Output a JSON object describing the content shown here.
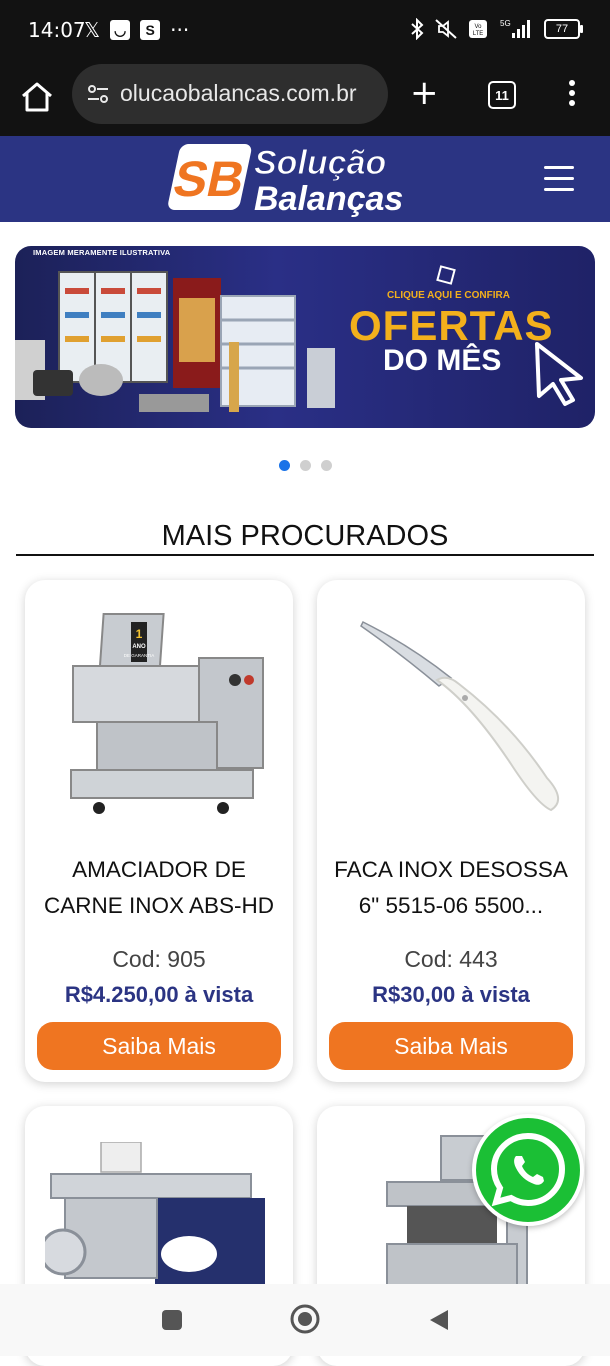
{
  "statusbar": {
    "time": "14:07",
    "battery": "77",
    "left_icons": [
      "x-icon",
      "smiley-icon",
      "s-icon",
      "more-icon"
    ],
    "right_icons": [
      "bluetooth-icon",
      "mute-icon",
      "volte-icon",
      "signal-5g-icon"
    ],
    "net_label": "5G"
  },
  "browser": {
    "url": "olucaobalancas.com.br",
    "tab_count": "11"
  },
  "header": {
    "logo_line1": "Solução",
    "logo_line2": "Balanças",
    "logo_mark": "SB"
  },
  "banner": {
    "note": "IMAGEM MERAMENTE ILUSTRATIVA",
    "cta": "CLIQUE AQUI E CONFIRA",
    "headline1": "OFERTAS",
    "headline2": "DO MÊS",
    "slides": 3,
    "active_slide": 1
  },
  "section": {
    "title": "MAIS PROCURADOS"
  },
  "products": [
    {
      "name": "AMACIADOR DE CARNE INOX ABS-HD",
      "code": "Cod: 905",
      "price": "R$4.250,00 à vista",
      "button": "Saiba Mais",
      "badge_1": "1",
      "badge_2": "ANO",
      "badge_3": "DE GARANTIA"
    },
    {
      "name": "FACA INOX DESOSSA 6\" 5515-06 5500...",
      "code": "Cod: 443",
      "price": "R$30,00 à vista",
      "button": "Saiba Mais"
    },
    {
      "name": "",
      "code": "",
      "price": "",
      "button": ""
    },
    {
      "name": "",
      "code": "",
      "price": "",
      "button": ""
    }
  ],
  "colors": {
    "header_bg": "#2b3483",
    "accent_orange": "#ef7521",
    "price_blue": "#2b3483",
    "whatsapp_green": "#1bbf35"
  }
}
